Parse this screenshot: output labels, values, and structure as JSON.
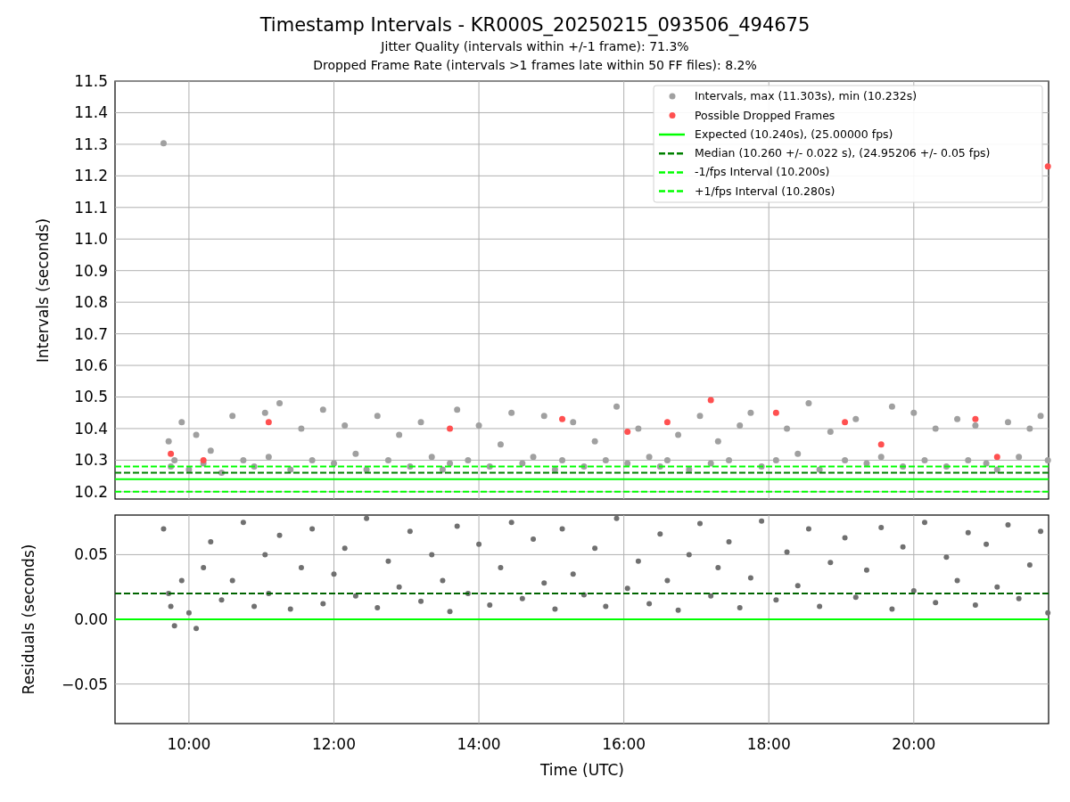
{
  "figure": {
    "title": "Timestamp Intervals - KR000S_20250215_093506_494675",
    "subtitles": [
      "Jitter Quality (intervals within +/-1 frame): 71.3%",
      "Dropped Frame Rate (intervals >1 frames late within 50 FF files): 8.2%"
    ]
  },
  "top_panel": {
    "chart_data": {
      "type": "scatter",
      "ylabel": "Intervals (seconds)",
      "xlim": [
        8.98,
        21.86
      ],
      "ylim": [
        10.177,
        11.5
      ],
      "yticks": [
        {
          "value": 10.2,
          "label": "10.2"
        },
        {
          "value": 10.3,
          "label": "10.3"
        },
        {
          "value": 10.4,
          "label": "10.4"
        },
        {
          "value": 10.5,
          "label": "10.5"
        },
        {
          "value": 10.6,
          "label": "10.6"
        },
        {
          "value": 10.7,
          "label": "10.7"
        },
        {
          "value": 10.8,
          "label": "10.8"
        },
        {
          "value": 10.9,
          "label": "10.9"
        },
        {
          "value": 11.0,
          "label": "11.0"
        },
        {
          "value": 11.1,
          "label": "11.1"
        },
        {
          "value": 11.2,
          "label": "11.2"
        },
        {
          "value": 11.3,
          "label": "11.3"
        },
        {
          "value": 11.4,
          "label": "11.4"
        },
        {
          "value": 11.5,
          "label": "11.5"
        }
      ],
      "x": [
        9.65,
        9.72,
        9.75,
        9.8,
        9.9,
        10.0,
        10.1,
        10.2,
        10.3,
        10.45,
        10.6,
        10.75,
        10.9,
        11.05,
        11.1,
        11.25,
        11.4,
        11.55,
        11.7,
        11.85,
        12.0,
        12.15,
        12.3,
        12.45,
        12.6,
        12.75,
        12.9,
        13.05,
        13.2,
        13.35,
        13.5,
        13.6,
        13.7,
        13.85,
        14.0,
        14.15,
        14.3,
        14.45,
        14.6,
        14.75,
        14.9,
        15.05,
        15.15,
        15.3,
        15.45,
        15.6,
        15.75,
        15.9,
        16.05,
        16.2,
        16.35,
        16.5,
        16.6,
        16.75,
        16.9,
        17.05,
        17.2,
        17.3,
        17.45,
        17.6,
        17.75,
        17.9,
        18.1,
        18.25,
        18.4,
        18.55,
        18.7,
        18.85,
        19.05,
        19.2,
        19.35,
        19.55,
        19.7,
        19.85,
        20.0,
        20.15,
        20.3,
        20.45,
        20.6,
        20.75,
        20.85,
        21.0,
        21.15,
        21.3,
        21.45,
        21.6,
        21.75,
        21.85
      ],
      "series": [
        {
          "name": "Intervals, max (11.303s), min (10.232s)",
          "color": "#a0a0a0",
          "values": [
            11.303,
            10.36,
            10.28,
            10.3,
            10.42,
            10.27,
            10.38,
            10.29,
            10.33,
            10.26,
            10.44,
            10.3,
            10.28,
            10.45,
            10.31,
            10.48,
            10.27,
            10.4,
            10.3,
            10.46,
            10.29,
            10.41,
            10.32,
            10.27,
            10.44,
            10.3,
            10.38,
            10.28,
            10.42,
            10.31,
            10.27,
            10.29,
            10.46,
            10.3,
            10.41,
            10.28,
            10.35,
            10.45,
            10.29,
            10.31,
            10.44,
            10.27,
            10.3,
            10.42,
            10.28,
            10.36,
            10.3,
            10.47,
            10.29,
            10.4,
            10.31,
            10.28,
            10.3,
            10.38,
            10.27,
            10.44,
            10.29,
            10.36,
            10.3,
            10.41,
            10.45,
            10.28,
            10.3,
            10.4,
            10.32,
            10.48,
            10.27,
            10.39,
            10.3,
            10.43,
            10.29,
            10.31,
            10.47,
            10.28,
            10.45,
            10.3,
            10.4,
            10.28,
            10.43,
            10.3,
            10.41,
            10.29,
            10.27,
            10.42,
            10.31,
            10.4,
            10.44,
            10.3
          ]
        },
        {
          "name": "Possible Dropped Frames",
          "color": "#ff5050",
          "values": [
            null,
            null,
            10.32,
            null,
            null,
            null,
            null,
            10.3,
            null,
            null,
            null,
            null,
            null,
            null,
            10.42,
            null,
            null,
            null,
            null,
            null,
            null,
            null,
            null,
            null,
            null,
            null,
            null,
            null,
            null,
            null,
            null,
            10.4,
            null,
            null,
            null,
            null,
            null,
            null,
            null,
            null,
            null,
            null,
            10.43,
            null,
            null,
            null,
            null,
            null,
            10.39,
            null,
            null,
            null,
            10.42,
            null,
            null,
            null,
            10.49,
            null,
            null,
            null,
            null,
            null,
            10.45,
            null,
            null,
            null,
            null,
            null,
            10.42,
            null,
            null,
            10.35,
            null,
            null,
            null,
            null,
            null,
            null,
            null,
            null,
            10.43,
            null,
            10.31,
            null,
            null,
            null,
            null,
            11.23
          ]
        }
      ],
      "grid": true,
      "ref_lines": [
        {
          "axis": "y",
          "value": 10.24,
          "label": "Expected (10.240s), (25.00000 fps)",
          "color": "#00ff00"
        },
        {
          "axis": "y",
          "value": 10.26,
          "label": "Median (10.260 +/- 0.022 s), (24.95206 +/- 0.05 fps)",
          "color": "#008000"
        },
        {
          "axis": "y",
          "value": 10.2,
          "label": "-1/fps Interval (10.200s)",
          "color": "#00ff00"
        },
        {
          "axis": "y",
          "value": 10.28,
          "label": "+1/fps Interval (10.280s)",
          "color": "#00ff00"
        }
      ],
      "legend": true
    }
  },
  "bottom_panel": {
    "chart_data": {
      "type": "scatter",
      "xlabel": "Time (UTC)",
      "ylabel": "Residuals (seconds)",
      "xlim": [
        8.98,
        21.86
      ],
      "ylim": [
        -0.0806,
        0.0806
      ],
      "xticks": [
        {
          "value": 10,
          "label": "10:00"
        },
        {
          "value": 12,
          "label": "12:00"
        },
        {
          "value": 14,
          "label": "14:00"
        },
        {
          "value": 16,
          "label": "16:00"
        },
        {
          "value": 18,
          "label": "18:00"
        },
        {
          "value": 20,
          "label": "20:00"
        }
      ],
      "yticks": [
        {
          "value": -0.05,
          "label": "−0.05"
        },
        {
          "value": 0,
          "label": "0.00"
        },
        {
          "value": 0.05,
          "label": "0.05"
        }
      ],
      "x": [
        9.65,
        9.72,
        9.75,
        9.8,
        9.9,
        10.0,
        10.1,
        10.2,
        10.3,
        10.45,
        10.6,
        10.75,
        10.9,
        11.05,
        11.1,
        11.25,
        11.4,
        11.55,
        11.7,
        11.85,
        12.0,
        12.15,
        12.3,
        12.45,
        12.6,
        12.75,
        12.9,
        13.05,
        13.2,
        13.35,
        13.5,
        13.6,
        13.7,
        13.85,
        14.0,
        14.15,
        14.3,
        14.45,
        14.6,
        14.75,
        14.9,
        15.05,
        15.15,
        15.3,
        15.45,
        15.6,
        15.75,
        15.9,
        16.05,
        16.2,
        16.35,
        16.5,
        16.6,
        16.75,
        16.9,
        17.05,
        17.2,
        17.3,
        17.45,
        17.6,
        17.75,
        17.9,
        18.1,
        18.25,
        18.4,
        18.55,
        18.7,
        18.85,
        19.05,
        19.2,
        19.35,
        19.55,
        19.7,
        19.85,
        20.0,
        20.15,
        20.3,
        20.45,
        20.6,
        20.75,
        20.85,
        21.0,
        21.15,
        21.3,
        21.45,
        21.6,
        21.75,
        21.85
      ],
      "series": [
        {
          "color": "#707070",
          "values": [
            0.07,
            0.02,
            0.01,
            -0.005,
            0.03,
            0.005,
            -0.007,
            0.04,
            0.06,
            0.015,
            0.03,
            0.075,
            0.01,
            0.05,
            0.02,
            0.065,
            0.008,
            0.04,
            0.07,
            0.012,
            0.035,
            0.055,
            0.018,
            0.078,
            0.009,
            0.045,
            0.025,
            0.068,
            0.014,
            0.05,
            0.03,
            0.006,
            0.072,
            0.02,
            0.058,
            0.011,
            0.04,
            0.075,
            0.016,
            0.062,
            0.028,
            0.008,
            0.07,
            0.035,
            0.019,
            0.055,
            0.01,
            0.078,
            0.024,
            0.045,
            0.012,
            0.066,
            0.03,
            0.007,
            0.05,
            0.074,
            0.018,
            0.04,
            0.06,
            0.009,
            0.032,
            0.076,
            0.015,
            0.052,
            0.026,
            0.07,
            0.01,
            0.044,
            0.063,
            0.017,
            0.038,
            0.071,
            0.008,
            0.056,
            0.022,
            0.075,
            0.013,
            0.048,
            0.03,
            0.067,
            0.011,
            0.058,
            0.025,
            0.073,
            0.016,
            0.042,
            0.068,
            0.005
          ]
        }
      ],
      "grid": true,
      "ref_lines": [
        {
          "axis": "y",
          "value": 0,
          "color": "#00ff00"
        },
        {
          "axis": "y",
          "value": 0.02,
          "color": "#006400"
        }
      ]
    }
  }
}
